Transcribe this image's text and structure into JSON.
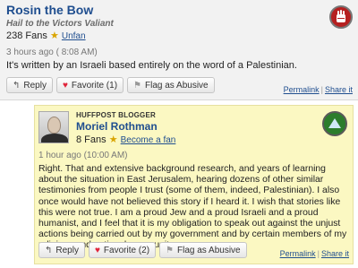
{
  "comment1": {
    "author": "Rosin the Bow",
    "subtitle": "Hail to the Victors Valiant",
    "fans": "238 Fans",
    "unfan": "Unfan",
    "time": "3 hours ago ( 8:08 AM)",
    "text": "It's written by an Israeli based entirely on the word of a Palestinian.",
    "reply": "Reply",
    "favorite": "Favorite (1)",
    "flag": "Flag as Abusive",
    "permalink": "Permalink",
    "share": "Share it",
    "badge_icon": "fist-badge-icon"
  },
  "comment2": {
    "label": "HUFFPOST BLOGGER",
    "author": "Moriel Rothman",
    "fans": "8 Fans",
    "become_fan": "Become a fan",
    "time": "1 hour ago (10:00 AM)",
    "text": "Right. That and extensive background research, and years of learning about the situation in East Jerusalem, hearing dozens of other similar testimonies from people I trust (some of them, indeed, Palestinian). I also once would have not believed this story if I heard it. I wish that stories like this were not true. I am a proud Jew and a proud Israeli and a proud humanist, and I feel that it is my obligation to speak out against the unjust actions being carried out by my government and by certain members of my religious and national community.",
    "reply": "Reply",
    "favorite": "Favorite (2)",
    "flag": "Flag as Abusive",
    "permalink": "Permalink",
    "share": "Share it",
    "badge_icon": "blogger-badge-icon"
  },
  "colors": {
    "link": "#1f4e8f",
    "reply_bg": "#fbf8c2",
    "comment_bg": "#f2f2f2"
  }
}
